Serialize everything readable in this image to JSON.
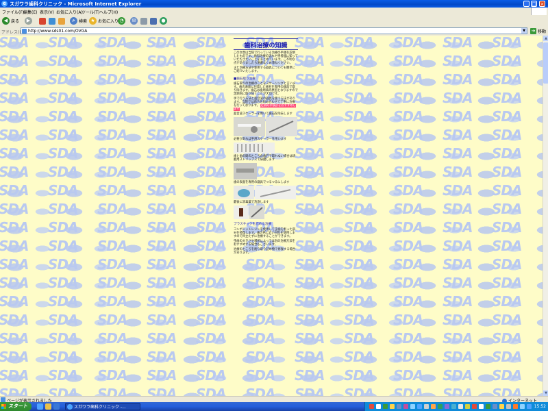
{
  "window": {
    "title": "スガワラ歯科クリニック - Microsoft Internet Explorer",
    "controls": [
      "_",
      "□",
      "×"
    ]
  },
  "menu": [
    "ファイル(F)",
    "編集(E)",
    "表示(V)",
    "お気に入り(A)",
    "ツール(T)",
    "ヘルプ(H)"
  ],
  "toolbar": {
    "back_label": "戻る",
    "search_label": "検索",
    "favorites_label": "お気に入り"
  },
  "address": {
    "label": "アドレス(D)",
    "url": "http://www.sds01.com/OVGA",
    "go_label": "移動"
  },
  "page": {
    "watermark": "SDA",
    "title": "歯科治療の知識",
    "para1": "この文章は当院で行っている治療の手順を説明したものです。歯科治療の流れや患者様に知っていただきたいことをまとめています。ご不明な点がありましたら遠慮なくお尋ねください。",
    "para2": "また治療方法や使用する器具についても簡単にご紹介いたします。",
    "section1": "■歯石取り治療",
    "para3": "歯石取りの治療のことをスケーリングと言います。歯の表面に付着した歯石を専用の器具で取り除きます。歯石は歯周病の原因となりますので定期的に取り除くことが大切です。",
    "para4": "手で行う方法と超音波の器具を使う方法があります。当院では両方を組み合わせて丁寧に治療を行っております。",
    "highlight": "定期的な検診をおすすめします",
    "cap1": "超音波スケーラーを用いて歯石を除去します",
    "cap2": "必要があれば手用スケーラーを用います",
    "cap3": "歯と歯の間のところの歯石で取れない場合は研磨用ストリップスで研磨します",
    "cap4": "歯の表面を専用の器具でつるつるにします",
    "cap5": "最後に消毒薬で洗浄します",
    "section2": "プラスチックを詰める治療",
    "para5": "コンポジットレジンを使用して虫歯を削った部分を修復します。歯の色に近い材料を使用しますので目立たずに治療することができます。",
    "para6": "虫歯の大きさや場所によっては別の治療方法をおすすめする場合もございます。",
    "para7": "治療のところを削り取り詰め物で修復する場合があります。"
  },
  "status": {
    "text": "ページが表示されました",
    "zone": "インターネット"
  },
  "taskbar": {
    "start": "スタート",
    "task": "スガワラ歯科クリニック -...",
    "clock": "15:52"
  }
}
